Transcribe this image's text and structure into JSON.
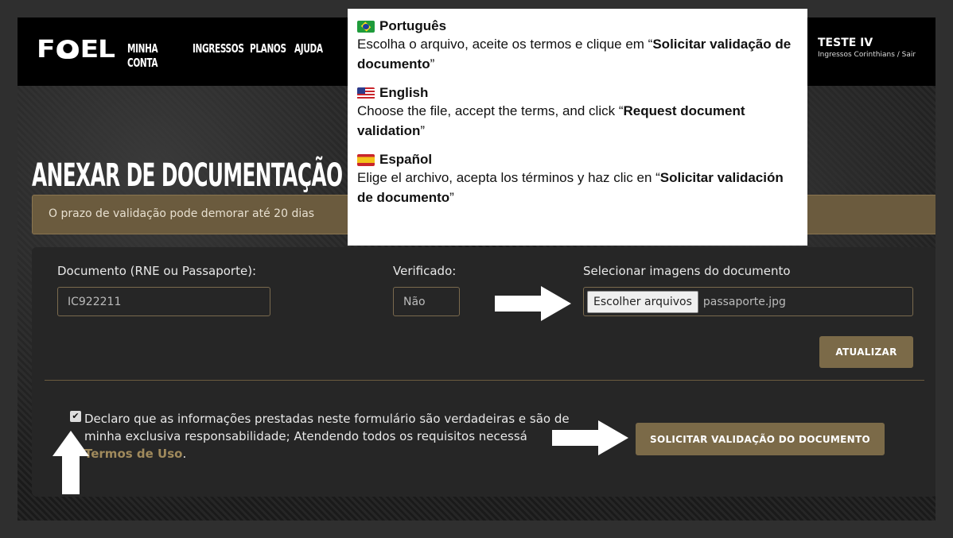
{
  "header": {
    "logo_text": "FIEL",
    "nav": [
      "MINHA CONTA",
      "INGRESSOS",
      "PLANOS",
      "AJUDA"
    ],
    "user_name": "TESTE IV",
    "user_links": "Ingressos Corinthians / Sair"
  },
  "page": {
    "title": "ANEXAR DE DOCUMENTAÇÃO",
    "notice": "O prazo de validação pode demorar até 20 dias"
  },
  "form": {
    "doc_label": "Documento (RNE ou Passaporte):",
    "doc_value": "IC922211",
    "verified_label": "Verificado:",
    "verified_value": "Não",
    "images_label": "Selecionar imagens do documento",
    "file_button": "Escolher arquivos",
    "file_name": "passaporte.jpg",
    "update_button": "ATUALIZAR",
    "checkbox_checked": true,
    "declaration_line1": "Declaro que as informações prestadas neste formulário são verdadeiras e são de",
    "declaration_line2": "minha exclusiva responsabilidade; Atendendo todos os requisitos necessá",
    "terms_link": "Termos de Uso",
    "terms_suffix": ".",
    "submit_button": "SOLICITAR VALIDAÇÃO DO DOCUMENTO"
  },
  "instructions": [
    {
      "flag": "brazil-flag",
      "language": "Português",
      "pre": "Escolha o arquivo, aceite os termos e clique em “",
      "bold": "Solicitar validação de documento",
      "post": "”"
    },
    {
      "flag": "usa-flag",
      "language": "English",
      "pre": "Choose the file, accept the terms, and click “",
      "bold": "Request document validation",
      "post": "”"
    },
    {
      "flag": "spain-flag",
      "language": "Español",
      "pre": "Elige el archivo, acepta los términos y haz clic en “",
      "bold": "Solicitar validación de documento",
      "post": "”"
    }
  ],
  "colors": {
    "accent": "#7b6a48",
    "notice_bg": "#6b5b3e",
    "card_bg": "#262626",
    "header_bg": "#000000"
  }
}
